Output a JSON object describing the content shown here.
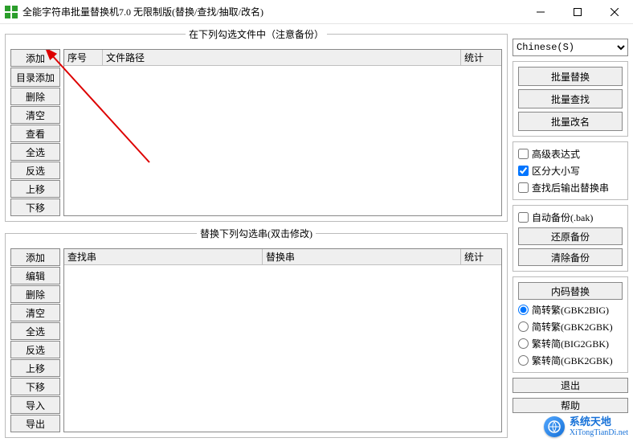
{
  "window": {
    "title": "全能字符串批量替换机7.0 无限制版(替换/查找/抽取/改名)"
  },
  "filesPanel": {
    "legend": "在下列勾选文件中（注意备份）",
    "buttons": [
      "添加",
      "目录添加",
      "删除",
      "清空",
      "查看",
      "全选",
      "反选",
      "上移",
      "下移"
    ],
    "columns": {
      "seq": "序号",
      "path": "文件路径",
      "stat": "统计"
    }
  },
  "stringsPanel": {
    "legend": "替换下列勾选串(双击修改)",
    "buttons": [
      "添加",
      "编辑",
      "删除",
      "清空",
      "全选",
      "反选",
      "上移",
      "下移",
      "导入",
      "导出"
    ],
    "columns": {
      "find": "查找串",
      "replace": "替换串",
      "stat": "统计"
    }
  },
  "side": {
    "language": {
      "options": [
        "Chinese(S)"
      ],
      "selected": "Chinese(S)"
    },
    "mainActions": {
      "batchReplace": "批量替换",
      "batchFind": "批量查找",
      "batchRename": "批量改名"
    },
    "options": {
      "advRegex": {
        "label": "高级表达式",
        "checked": false
      },
      "caseSensitive": {
        "label": "区分大小写",
        "checked": true
      },
      "outputAfterFind": {
        "label": "查找后输出替换串",
        "checked": false
      }
    },
    "backup": {
      "autoBackup": {
        "label": "自动备份(.bak)",
        "checked": false
      },
      "restore": "还原备份",
      "clear": "清除备份"
    },
    "encoding": {
      "title": "内码替换",
      "options": [
        {
          "label": "简转繁(GBK2BIG)",
          "value": "gbk2big"
        },
        {
          "label": "简转繁(GBK2GBK)",
          "value": "gbk2gbk"
        },
        {
          "label": "繁转简(BIG2GBK)",
          "value": "big2gbk"
        },
        {
          "label": "繁转简(GBK2GBK)",
          "value": "gbk2gbk2"
        }
      ],
      "selected": "gbk2big"
    },
    "exit": "退出",
    "help": "帮助"
  },
  "watermark": {
    "line1": "系统天地",
    "line2": "XiTongTianDi.net"
  }
}
